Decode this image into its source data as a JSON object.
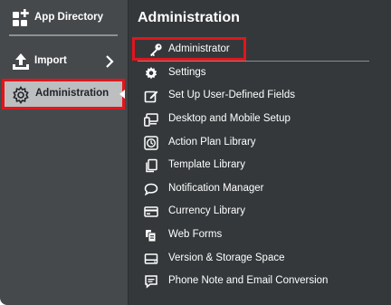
{
  "sidebar": {
    "items": [
      {
        "label": "App Directory",
        "icon": "app-directory-icon"
      },
      {
        "label": "Import",
        "icon": "import-icon"
      },
      {
        "label": "Administration",
        "icon": "gear-icon",
        "selected": true
      }
    ]
  },
  "panel": {
    "title": "Administration",
    "items": [
      {
        "label": "Administrator",
        "icon": "key-icon",
        "highlighted": true
      },
      {
        "label": "Settings",
        "icon": "gear-icon"
      },
      {
        "label": "Set Up User-Defined Fields",
        "icon": "edit-fields-icon"
      },
      {
        "label": "Desktop and Mobile Setup",
        "icon": "devices-icon"
      },
      {
        "label": "Action Plan Library",
        "icon": "clock-icon"
      },
      {
        "label": "Template Library",
        "icon": "copy-icon"
      },
      {
        "label": "Notification Manager",
        "icon": "speech-bubble-icon"
      },
      {
        "label": "Currency Library",
        "icon": "currency-card-icon"
      },
      {
        "label": "Web Forms",
        "icon": "web-forms-icon"
      },
      {
        "label": "Version & Storage Space",
        "icon": "storage-icon"
      },
      {
        "label": "Phone Note and Email Conversion",
        "icon": "message-icon"
      }
    ]
  },
  "colors": {
    "sidebar_bg": "#46494c",
    "panel_bg": "#34383b",
    "selected_bg": "#bcbec0",
    "highlight_border": "#e0161c"
  }
}
